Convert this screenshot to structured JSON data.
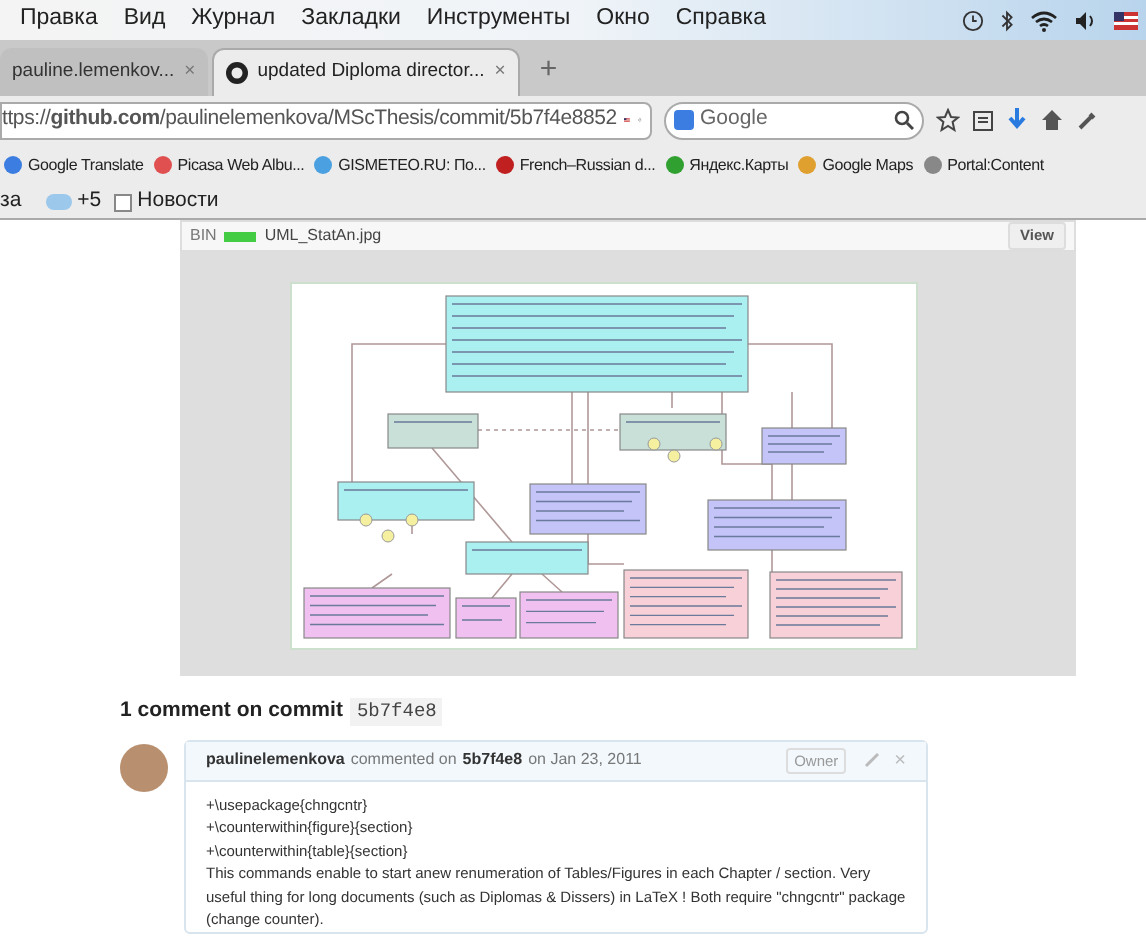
{
  "menu_bar": {
    "items": [
      "Правка",
      "Вид",
      "Журнал",
      "Закладки",
      "Инструменты",
      "Окно",
      "Справка"
    ]
  },
  "tabs": [
    {
      "title": "pauline.lemenkov...",
      "selected": false,
      "close": "×"
    },
    {
      "title": "updated Diploma director...",
      "selected": true,
      "close": "×"
    }
  ],
  "new_tab": "+",
  "address_bar": {
    "url": "ttps://**github.com**/paulinelemenkova/MScThesis/commit/5b7f4e8852"
  },
  "search_field": {
    "placeholder": "Google"
  },
  "bookmarks": [
    "Google Translate",
    "Picasa Web Albu...",
    "GISMETEO.RU: По...",
    "French–Russian d...",
    "Яндекс.Карты",
    "Google Maps",
    "Portal:Content"
  ],
  "bookmarks_row_2": [
    "за",
    "+5",
    "Новости"
  ],
  "file_header": {
    "label": "BIN",
    "name": "UML_StatAn.jpg",
    "view_button": "View"
  },
  "comments_heading": {
    "text": "1 comment on commit",
    "sha": "5b7f4e8"
  },
  "comment": {
    "author": "paulinelemenkova",
    "action": "commented on",
    "sha": "5b7f4e8",
    "date": "on Jan 23, 2011",
    "badge": "Owner",
    "close": "×",
    "lines": [
      "+\\usepackage{chngcntr}",
      "+\\counterwithin{figure}{section}",
      "+\\counterwithin{table}{section}",
      "This commands enable to start anew renumeration of Tables/Figures in each Chapter / section. Very useful thing for long documents (such as Diplomas & Dissers) in LaTeX ! Both require \"chngcntr\" package (change counter)."
    ]
  }
}
